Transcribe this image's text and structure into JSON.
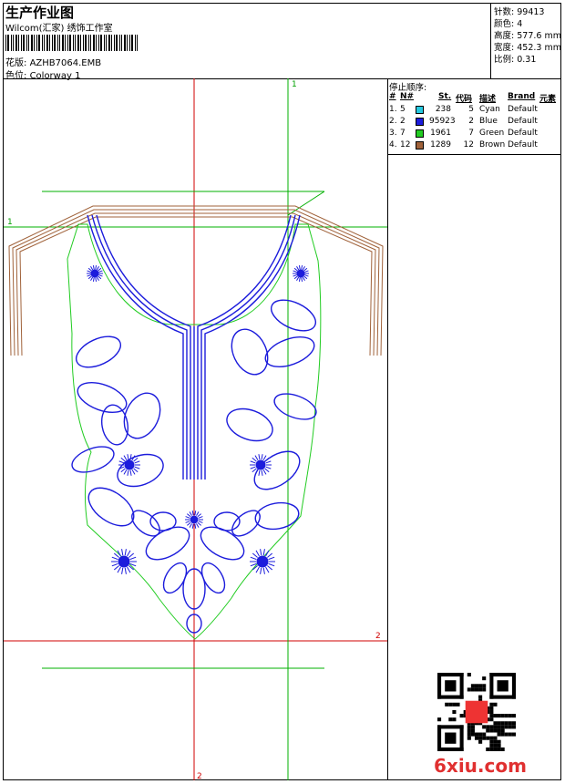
{
  "header": {
    "title": "生产作业图",
    "company": "Wilcom(汇家) 绣饰工作室",
    "design_label": "花版:",
    "design_value": "AZHB7064.EMB",
    "colorway_label": "色位:",
    "colorway_value": "Colorway 1"
  },
  "stats": {
    "stitches_label": "针数:",
    "stitches_value": "99413",
    "colors_label": "颜色:",
    "colors_value": "4",
    "height_label": "高度:",
    "height_value": "577.6 mm",
    "width_label": "宽度:",
    "width_value": "452.3 mm",
    "scale_label": "比例:",
    "scale_value": "0.31"
  },
  "stop_sequence": {
    "title": "停止顺序:",
    "headers": [
      "#",
      "N#",
      "St.",
      "代码",
      "描述",
      "Brand",
      "元素"
    ],
    "rows": [
      {
        "idx": "1.",
        "n": "5",
        "color": "#26c9e0",
        "st": "238",
        "code": "5",
        "desc": "Cyan",
        "brand": "Default"
      },
      {
        "idx": "2.",
        "n": "2",
        "color": "#1c1cdc",
        "st": "95923",
        "code": "2",
        "desc": "Blue",
        "brand": "Default"
      },
      {
        "idx": "3.",
        "n": "7",
        "color": "#22cc22",
        "st": "1961",
        "code": "7",
        "desc": "Green",
        "brand": "Default"
      },
      {
        "idx": "4.",
        "n": "12",
        "color": "#a0623a",
        "st": "1289",
        "code": "12",
        "desc": "Brown",
        "brand": "Default"
      }
    ]
  },
  "guides": {
    "marker_1": "1",
    "marker_2": "2"
  },
  "watermark": "6xiu.com",
  "colors": {
    "thread_blue": "#1c1cdc",
    "outline_green": "#22cc22",
    "guide_red": "#d00000",
    "neck_brown": "#a0623a",
    "guide_green": "#00b000"
  }
}
